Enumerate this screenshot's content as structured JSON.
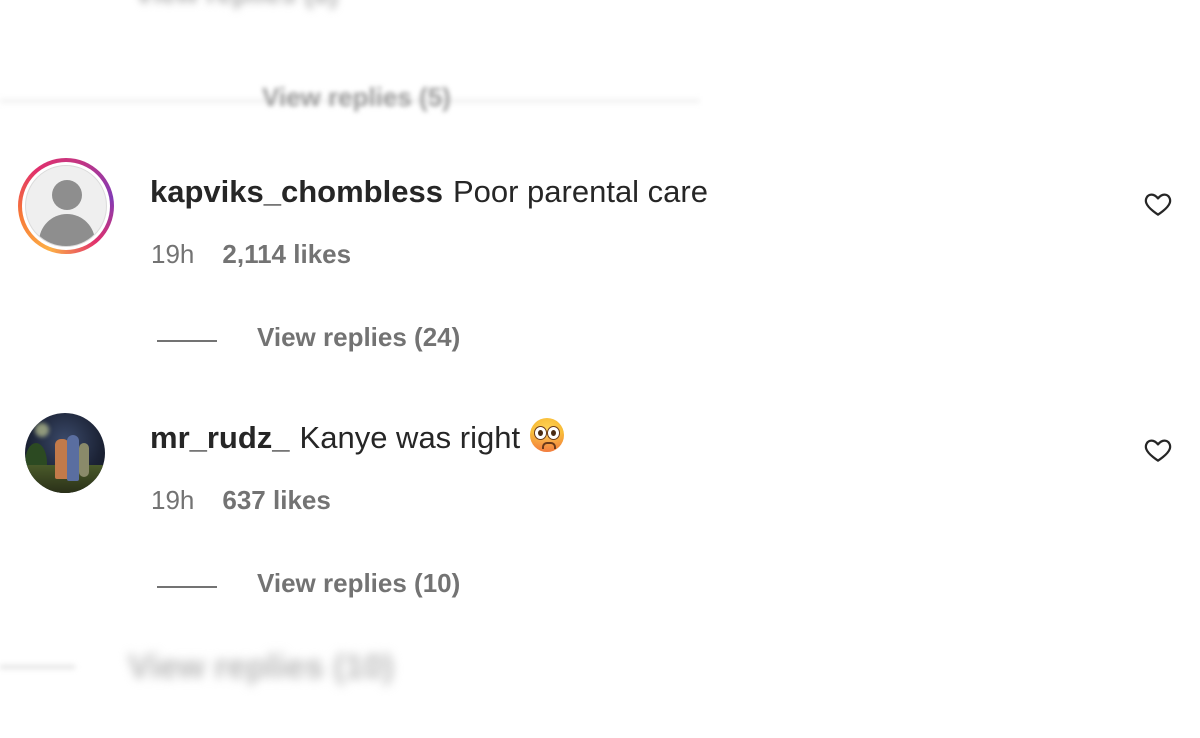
{
  "ghost_top": "View replies (8)",
  "ghost_mid": "View replies (5)",
  "ghost_bottom": "View replies (10)",
  "comments": [
    {
      "username": "kapviks_chombless",
      "text": "Poor parental care",
      "time": "19h",
      "likes": "2,114 likes",
      "replies": "View replies (24)",
      "avatar": "default-profile-with-story-ring"
    },
    {
      "username": "mr_rudz_",
      "text": "Kanye was right",
      "emoji": "flushed-face-emoji",
      "time": "19h",
      "likes": "637 likes",
      "replies": "View replies (10)",
      "avatar": "photo-avatar"
    }
  ],
  "icons": {
    "like": "heart-outline-icon"
  }
}
